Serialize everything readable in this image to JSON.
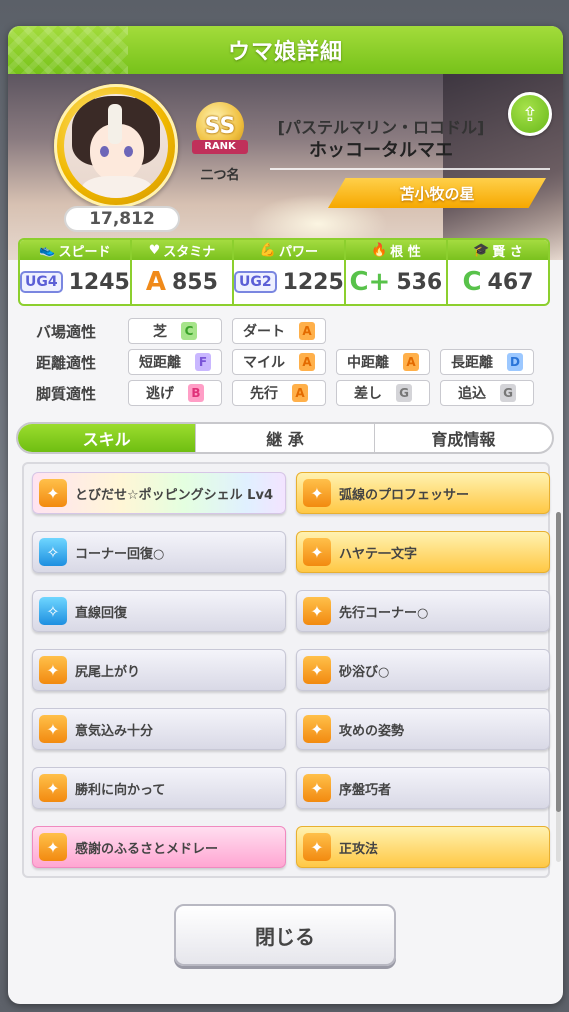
{
  "header": {
    "title": "ウマ娘詳細"
  },
  "character": {
    "fans": "17,812",
    "rank": "SS",
    "rank_ribbon": "RANK",
    "rank_label": "二つ名",
    "alt_title": "[パステルマリン・ロコドル]",
    "name": "ホッコータルマエ",
    "epithet": "苫小牧の星"
  },
  "stats": [
    {
      "label": "スピード",
      "icon": "speed-icon",
      "grade": "UG4",
      "value": "1245"
    },
    {
      "label": "スタミナ",
      "icon": "heart-icon",
      "grade": "A",
      "value": "855"
    },
    {
      "label": "パワー",
      "icon": "power-icon",
      "grade": "UG2",
      "value": "1225"
    },
    {
      "label": "根 性",
      "icon": "flame-icon",
      "grade": "C+",
      "value": "536"
    },
    {
      "label": "賢 さ",
      "icon": "cap-icon",
      "grade": "C",
      "value": "467"
    }
  ],
  "aptitudes": {
    "track": {
      "label": "バ場適性",
      "items": [
        {
          "name": "芝",
          "grade": "C"
        },
        {
          "name": "ダート",
          "grade": "A"
        }
      ]
    },
    "distance": {
      "label": "距離適性",
      "items": [
        {
          "name": "短距離",
          "grade": "F"
        },
        {
          "name": "マイル",
          "grade": "A"
        },
        {
          "name": "中距離",
          "grade": "A"
        },
        {
          "name": "長距離",
          "grade": "D"
        }
      ]
    },
    "style": {
      "label": "脚質適性",
      "items": [
        {
          "name": "逃げ",
          "grade": "B"
        },
        {
          "name": "先行",
          "grade": "A"
        },
        {
          "name": "差し",
          "grade": "G"
        },
        {
          "name": "追込",
          "grade": "G"
        }
      ]
    }
  },
  "tabs": [
    {
      "label": "スキル",
      "active": true
    },
    {
      "label": "継 承",
      "active": false
    },
    {
      "label": "育成情報",
      "active": false
    }
  ],
  "skills": {
    "left": [
      {
        "name": "とびだせ☆ポッピングシェル  Lv4",
        "style": "rainbow",
        "icon_color": "orange"
      },
      {
        "name": "コーナー回復○",
        "style": "normal",
        "icon_color": "blue"
      },
      {
        "name": "直線回復",
        "style": "normal",
        "icon_color": "blue"
      },
      {
        "name": "尻尾上がり",
        "style": "normal",
        "icon_color": "orange"
      },
      {
        "name": "意気込み十分",
        "style": "normal",
        "icon_color": "orange"
      },
      {
        "name": "勝利に向かって",
        "style": "normal",
        "icon_color": "orange"
      },
      {
        "name": "感謝のふるさとメドレー",
        "style": "pink",
        "icon_color": "orange"
      }
    ],
    "right": [
      {
        "name": "弧線のプロフェッサー",
        "style": "gold",
        "icon_color": "orange"
      },
      {
        "name": "ハヤテ一文字",
        "style": "gold",
        "icon_color": "orange"
      },
      {
        "name": "先行コーナー○",
        "style": "normal",
        "icon_color": "orange"
      },
      {
        "name": "砂浴び○",
        "style": "normal",
        "icon_color": "orange"
      },
      {
        "name": "攻めの姿勢",
        "style": "normal",
        "icon_color": "orange"
      },
      {
        "name": "序盤巧者",
        "style": "normal",
        "icon_color": "orange"
      },
      {
        "name": "正攻法",
        "style": "gold",
        "icon_color": "orange"
      }
    ]
  },
  "close_label": "閉じる",
  "colors": {
    "accent": "#7ac11e",
    "gold": "#f6a800",
    "pink": "#ff9ec6"
  }
}
